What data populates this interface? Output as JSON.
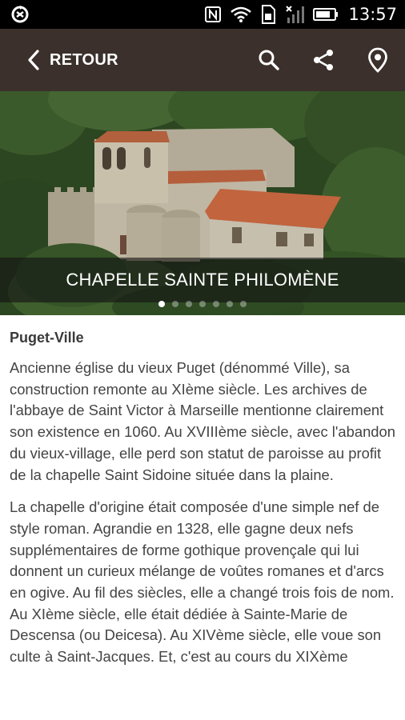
{
  "status_bar": {
    "time": "13:57",
    "icons": [
      "sync-icon",
      "nfc-icon",
      "wifi-icon",
      "sim-icon",
      "signal-icon",
      "battery-icon"
    ]
  },
  "action_bar": {
    "back_label": "RETOUR",
    "background": "#3b302b",
    "icons": [
      "search-icon",
      "share-icon",
      "map-pin-icon"
    ]
  },
  "hero": {
    "title": "CHAPELLE SAINTE PHILOMÈNE",
    "slides_total": 7,
    "active_slide": 1
  },
  "content": {
    "place": "Puget-Ville",
    "paragraphs": [
      "Ancienne église du vieux Puget (dénommé Ville), sa construction remonte au XIème siècle. Les archives de l'abbaye de Saint Victor à Marseille mentionne clairement son existence en 1060. Au XVIIIème siècle, avec l'abandon du vieux-village, elle perd son statut de paroisse au profit de la chapelle Saint Sidoine située dans la plaine.",
      "La chapelle d'origine était composée d'une simple nef de style roman. Agrandie en 1328, elle gagne deux nefs supplémentaires de forme gothique provençale qui lui donnent un curieux mélange de voûtes romanes et d'arcs en ogive. Au fil des siècles, elle a changé trois fois de nom. Au XIème siècle, elle était dédiée à Sainte-Marie de Descensa (ou Deicesa).  Au XIVème siècle, elle voue son culte à Saint-Jacques. Et, c'est au cours du XIXème"
    ]
  }
}
